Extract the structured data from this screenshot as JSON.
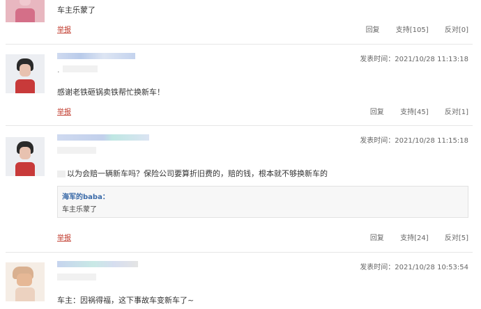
{
  "posts": [
    {
      "content": "车主乐蒙了",
      "report": "举报",
      "reply": "回复",
      "support": "支持[105]",
      "oppose": "反对[0]"
    },
    {
      "time_label": "发表时间：",
      "time": "2021/10/28 11:13:18",
      "sub": ".",
      "content": "感谢老铁砸锅卖铁帮忙换新车！",
      "report": "举报",
      "reply": "回复",
      "support": "支持[45]",
      "oppose": "反对[1]"
    },
    {
      "time_label": "发表时间：",
      "time": "2021/10/28 11:15:18",
      "content": "以为会赔一辆新车吗？保险公司要算折旧费的，赔的钱，根本就不够换新车的",
      "quote_name": "海军的baba：",
      "quote_text": "车主乐蒙了",
      "report": "举报",
      "reply": "回复",
      "support": "支持[24]",
      "oppose": "反对[5]"
    },
    {
      "time_label": "发表时间：",
      "time": "2021/10/28 10:53:54",
      "content": "车主：因祸得福，这下事故车变新车了~"
    }
  ]
}
